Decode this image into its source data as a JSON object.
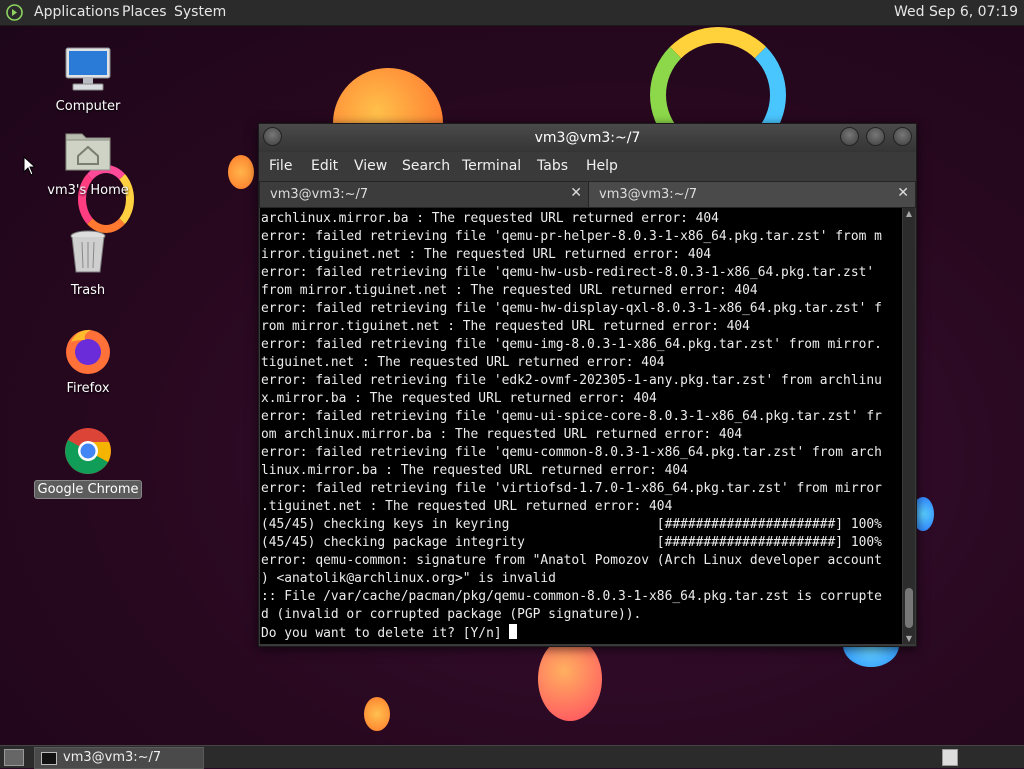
{
  "top_panel": {
    "menus": [
      "Applications",
      "Places",
      "System"
    ],
    "clock": "Wed Sep  6, 07:19"
  },
  "desktop_icons": {
    "computer": "Computer",
    "home": "vm3's Home",
    "trash": "Trash",
    "firefox": "Firefox",
    "chrome": "Google Chrome"
  },
  "window": {
    "title": "vm3@vm3:~/7",
    "menu": [
      "File",
      "Edit",
      "View",
      "Search",
      "Terminal",
      "Tabs",
      "Help"
    ],
    "tabs": [
      "vm3@vm3:~/7",
      "vm3@vm3:~/7"
    ],
    "lines": [
      "archlinux.mirror.ba : The requested URL returned error: 404",
      "error: failed retrieving file 'qemu-pr-helper-8.0.3-1-x86_64.pkg.tar.zst' from m",
      "irror.tiguinet.net : The requested URL returned error: 404",
      "error: failed retrieving file 'qemu-hw-usb-redirect-8.0.3-1-x86_64.pkg.tar.zst'",
      "from mirror.tiguinet.net : The requested URL returned error: 404",
      "error: failed retrieving file 'qemu-hw-display-qxl-8.0.3-1-x86_64.pkg.tar.zst' f",
      "rom mirror.tiguinet.net : The requested URL returned error: 404",
      "error: failed retrieving file 'qemu-img-8.0.3-1-x86_64.pkg.tar.zst' from mirror.",
      "tiguinet.net : The requested URL returned error: 404",
      "error: failed retrieving file 'edk2-ovmf-202305-1-any.pkg.tar.zst' from archlinu",
      "x.mirror.ba : The requested URL returned error: 404",
      "error: failed retrieving file 'qemu-ui-spice-core-8.0.3-1-x86_64.pkg.tar.zst' fr",
      "om archlinux.mirror.ba : The requested URL returned error: 404",
      "error: failed retrieving file 'qemu-common-8.0.3-1-x86_64.pkg.tar.zst' from arch",
      "linux.mirror.ba : The requested URL returned error: 404",
      "error: failed retrieving file 'virtiofsd-1.7.0-1-x86_64.pkg.tar.zst' from mirror",
      ".tiguinet.net : The requested URL returned error: 404",
      "(45/45) checking keys in keyring                   [######################] 100%",
      "(45/45) checking package integrity                 [######################] 100%",
      "error: qemu-common: signature from \"Anatol Pomozov (Arch Linux developer account",
      ") <anatolik@archlinux.org>\" is invalid",
      ":: File /var/cache/pacman/pkg/qemu-common-8.0.3-1-x86_64.pkg.tar.zst is corrupte",
      "d (invalid or corrupted package (PGP signature)).",
      "Do you want to delete it? [Y/n] "
    ]
  },
  "bottom_panel": {
    "task_label": "vm3@vm3:~/7"
  }
}
